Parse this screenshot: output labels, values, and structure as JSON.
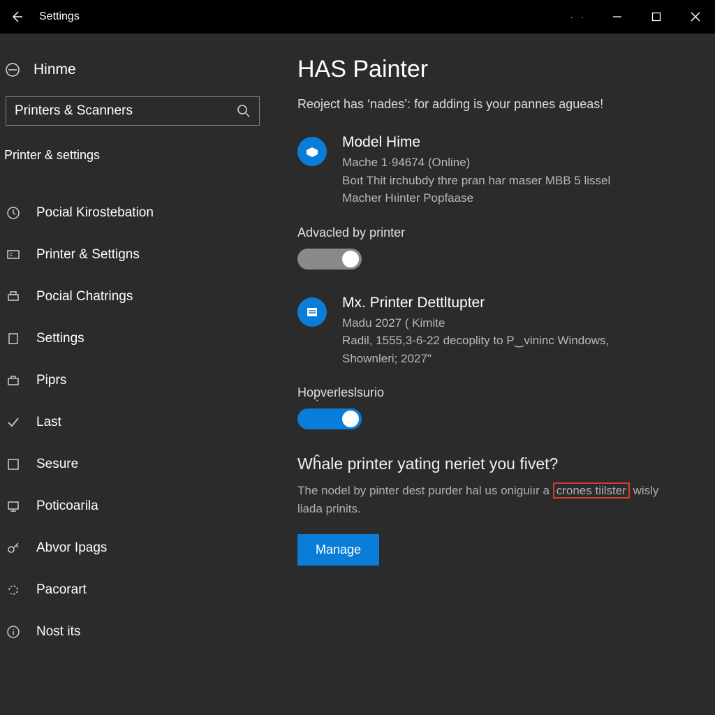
{
  "titlebar": {
    "title": "Settings"
  },
  "sidebar": {
    "home_label": "Hinme",
    "search_value": "Printers & Scanners",
    "header": "Printer & settings",
    "items": [
      {
        "label": "Pocial Kirostebation",
        "icon": "clock-icon"
      },
      {
        "label": "Printer & Settigns",
        "icon": "monitor-icon"
      },
      {
        "label": "Pocial Chatrings",
        "icon": "printer-icon"
      },
      {
        "label": "Settings",
        "icon": "tablet-icon"
      },
      {
        "label": "Piprs",
        "icon": "briefcase-icon"
      },
      {
        "label": "Last",
        "icon": "check-icon"
      },
      {
        "label": "Sesure",
        "icon": "square-icon"
      },
      {
        "label": "Poticoarila",
        "icon": "display-icon"
      },
      {
        "label": "Abvor Ipags",
        "icon": "key-icon"
      },
      {
        "label": "Pacorart",
        "icon": "refresh-icon"
      },
      {
        "label": "Nost its",
        "icon": "info-icon"
      }
    ]
  },
  "main": {
    "title": "HAS Painter",
    "subtitle": "Reoject has ‘nades’: for adding is your pannes agueas!",
    "device1": {
      "name": "Model Hime",
      "line1": "Mache 1·94⁨6⁨74 (Online)",
      "line2": "Boıt Thit irchubdy thre pran har maser MBB 5 lissel",
      "line3": "Macher Hıinter Popfaase"
    },
    "toggle1_label": "Advacled by printer",
    "device2": {
      "name": "Mx. Printer Dettltupter",
      "line1": "Madu 2027 ( Kimite",
      "line2": "Radil, 1555,3-6-22 decoplity to P‿vininc Windows,",
      "line3": "Shownleri; 2027\""
    },
    "toggle2_label": "Hop̣verleslsurio",
    "help_heading": "Wĥale printer yating neriet you fivet?",
    "help_text_a": "The nodel by pinter dest purder hal us oniguiır a ",
    "help_text_highlight": "crones tiilster",
    "help_text_b": " wisly liada prinits.",
    "manage_label": "Manage"
  }
}
